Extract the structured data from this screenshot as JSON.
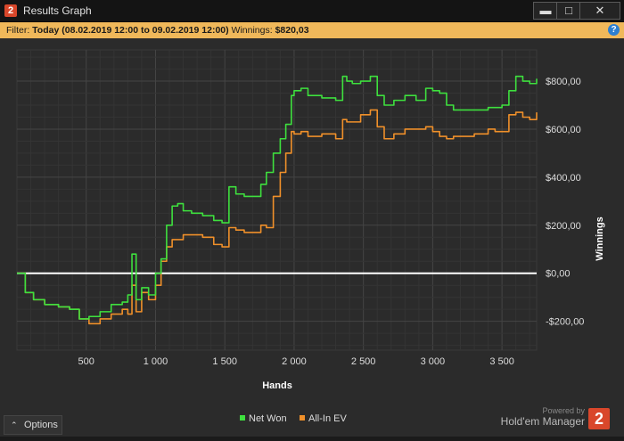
{
  "window": {
    "app_icon": "2",
    "title": "Results Graph",
    "minimize_icon": "▬",
    "maximize_icon": "□",
    "close_icon": "✕"
  },
  "filter": {
    "prefix": "Filter:",
    "value": "Today (08.02.2019 12:00 to 09.02.2019 12:00)",
    "winnings_label": "Winnings:",
    "winnings_value": "$820,03",
    "help_icon": "?"
  },
  "footer": {
    "options_icon": "⌃",
    "options_label": "Options",
    "powered_by": "Powered by",
    "brand": "Hold'em Manager",
    "brand_logo": "2"
  },
  "colors": {
    "net_won": "#3ee03e",
    "all_in_ev": "#f0902a",
    "zero_line": "#ffffff",
    "grid": "#3d3d3d",
    "plot_bg": "#2b2b2b"
  },
  "chart_data": {
    "type": "line",
    "xlabel": "Hands",
    "ylabel": "Winnings",
    "xlim": [
      0,
      3750
    ],
    "ylim": [
      -320,
      930
    ],
    "x_ticks": [
      500,
      1000,
      1500,
      2000,
      2500,
      3000,
      3500
    ],
    "x_tick_labels": [
      "500",
      "1 000",
      "1 500",
      "2 000",
      "2 500",
      "3 000",
      "3 500"
    ],
    "y_ticks": [
      -200,
      0,
      200,
      400,
      600,
      800
    ],
    "y_tick_labels": [
      "-$200,00",
      "$0,00",
      "$200,00",
      "$400,00",
      "$600,00",
      "$800,00"
    ],
    "grid": true,
    "legend_position": "bottom-center",
    "series": [
      {
        "name": "Net Won",
        "color": "#3ee03e",
        "x": [
          0,
          60,
          120,
          200,
          300,
          380,
          450,
          520,
          600,
          680,
          760,
          800,
          830,
          860,
          900,
          950,
          1000,
          1040,
          1080,
          1120,
          1160,
          1200,
          1260,
          1340,
          1420,
          1480,
          1530,
          1580,
          1640,
          1700,
          1760,
          1800,
          1850,
          1900,
          1940,
          1980,
          2000,
          2050,
          2100,
          2200,
          2300,
          2350,
          2380,
          2420,
          2480,
          2550,
          2600,
          2650,
          2720,
          2800,
          2880,
          2950,
          3000,
          3050,
          3100,
          3150,
          3200,
          3300,
          3400,
          3450,
          3500,
          3550,
          3600,
          3650,
          3700,
          3750
        ],
        "y": [
          0,
          -80,
          -110,
          -130,
          -140,
          -150,
          -190,
          -180,
          -160,
          -130,
          -120,
          -90,
          80,
          -110,
          -60,
          -90,
          0,
          60,
          200,
          280,
          290,
          260,
          250,
          240,
          220,
          210,
          360,
          330,
          320,
          320,
          370,
          420,
          500,
          560,
          620,
          740,
          760,
          770,
          740,
          730,
          720,
          820,
          800,
          790,
          800,
          820,
          740,
          700,
          720,
          740,
          720,
          770,
          760,
          750,
          700,
          680,
          680,
          680,
          690,
          690,
          700,
          760,
          820,
          800,
          790,
          810
        ]
      },
      {
        "name": "All-In EV",
        "color": "#f0902a",
        "x": [
          0,
          60,
          120,
          200,
          300,
          380,
          450,
          520,
          600,
          680,
          760,
          800,
          830,
          860,
          900,
          950,
          1000,
          1040,
          1080,
          1120,
          1160,
          1200,
          1260,
          1340,
          1420,
          1480,
          1530,
          1580,
          1640,
          1700,
          1760,
          1800,
          1850,
          1900,
          1940,
          1980,
          2000,
          2050,
          2100,
          2200,
          2300,
          2350,
          2380,
          2420,
          2480,
          2550,
          2600,
          2650,
          2720,
          2800,
          2880,
          2950,
          3000,
          3050,
          3100,
          3150,
          3200,
          3300,
          3400,
          3450,
          3500,
          3550,
          3600,
          3650,
          3700,
          3750
        ],
        "y": [
          0,
          -80,
          -110,
          -130,
          -140,
          -150,
          -190,
          -210,
          -190,
          -170,
          -150,
          -170,
          -50,
          -160,
          -80,
          -110,
          -50,
          50,
          110,
          140,
          140,
          160,
          160,
          150,
          120,
          110,
          190,
          180,
          170,
          170,
          200,
          190,
          320,
          420,
          500,
          590,
          580,
          590,
          570,
          580,
          560,
          640,
          630,
          630,
          660,
          680,
          610,
          560,
          580,
          600,
          600,
          610,
          590,
          570,
          560,
          570,
          570,
          580,
          600,
          590,
          590,
          660,
          670,
          650,
          640,
          670
        ]
      }
    ]
  }
}
